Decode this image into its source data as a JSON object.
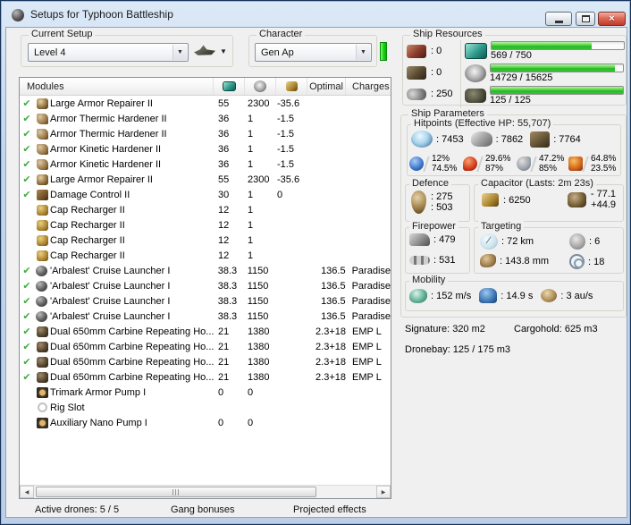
{
  "window": {
    "title": "Setups for Typhoon Battleship"
  },
  "setup": {
    "label": "Current Setup",
    "value": "Level 4"
  },
  "character": {
    "label": "Character",
    "value": "Gen Ap"
  },
  "modules_table": {
    "header": {
      "name": "Modules",
      "icons": [
        "cpu-icon",
        "powergrid-icon",
        "capacitor-icon"
      ],
      "optimal": "Optimal",
      "charges": "Charges"
    },
    "rows": [
      {
        "check": true,
        "icon": "repairer",
        "name": "Large Armor Repairer II",
        "cpu": "55",
        "pg": "2300",
        "cap": "-35.6",
        "optimal": "",
        "charges": ""
      },
      {
        "check": true,
        "icon": "hardener",
        "name": "Armor Thermic Hardener II",
        "cpu": "36",
        "pg": "1",
        "cap": "-1.5",
        "optimal": "",
        "charges": ""
      },
      {
        "check": true,
        "icon": "hardener",
        "name": "Armor Thermic Hardener II",
        "cpu": "36",
        "pg": "1",
        "cap": "-1.5",
        "optimal": "",
        "charges": ""
      },
      {
        "check": true,
        "icon": "hardener",
        "name": "Armor Kinetic Hardener II",
        "cpu": "36",
        "pg": "1",
        "cap": "-1.5",
        "optimal": "",
        "charges": ""
      },
      {
        "check": true,
        "icon": "hardener",
        "name": "Armor Kinetic Hardener II",
        "cpu": "36",
        "pg": "1",
        "cap": "-1.5",
        "optimal": "",
        "charges": ""
      },
      {
        "check": true,
        "icon": "repairer",
        "name": "Large Armor Repairer II",
        "cpu": "55",
        "pg": "2300",
        "cap": "-35.6",
        "optimal": "",
        "charges": ""
      },
      {
        "check": true,
        "icon": "damage-control",
        "name": "Damage Control II",
        "cpu": "30",
        "pg": "1",
        "cap": "0",
        "optimal": "",
        "charges": ""
      },
      {
        "check": false,
        "icon": "cap-recharger",
        "name": "Cap Recharger II",
        "cpu": "12",
        "pg": "1",
        "cap": "",
        "optimal": "",
        "charges": ""
      },
      {
        "check": false,
        "icon": "cap-recharger",
        "name": "Cap Recharger II",
        "cpu": "12",
        "pg": "1",
        "cap": "",
        "optimal": "",
        "charges": ""
      },
      {
        "check": false,
        "icon": "cap-recharger",
        "name": "Cap Recharger II",
        "cpu": "12",
        "pg": "1",
        "cap": "",
        "optimal": "",
        "charges": ""
      },
      {
        "check": false,
        "icon": "cap-recharger",
        "name": "Cap Recharger II",
        "cpu": "12",
        "pg": "1",
        "cap": "",
        "optimal": "",
        "charges": ""
      },
      {
        "check": true,
        "icon": "cruise-launcher",
        "name": "'Arbalest' Cruise Launcher I",
        "cpu": "38.3",
        "pg": "1150",
        "cap": "",
        "optimal": "136.5",
        "charges": "Paradise"
      },
      {
        "check": true,
        "icon": "cruise-launcher",
        "name": "'Arbalest' Cruise Launcher I",
        "cpu": "38.3",
        "pg": "1150",
        "cap": "",
        "optimal": "136.5",
        "charges": "Paradise"
      },
      {
        "check": true,
        "icon": "cruise-launcher",
        "name": "'Arbalest' Cruise Launcher I",
        "cpu": "38.3",
        "pg": "1150",
        "cap": "",
        "optimal": "136.5",
        "charges": "Paradise"
      },
      {
        "check": true,
        "icon": "cruise-launcher",
        "name": "'Arbalest' Cruise Launcher I",
        "cpu": "38.3",
        "pg": "1150",
        "cap": "",
        "optimal": "136.5",
        "charges": "Paradise"
      },
      {
        "check": true,
        "icon": "projectile-turret",
        "name": "Dual 650mm Carbine Repeating Ho...",
        "cpu": "21",
        "pg": "1380",
        "cap": "",
        "optimal": "2.3+18",
        "charges": "EMP L"
      },
      {
        "check": true,
        "icon": "projectile-turret",
        "name": "Dual 650mm Carbine Repeating Ho...",
        "cpu": "21",
        "pg": "1380",
        "cap": "",
        "optimal": "2.3+18",
        "charges": "EMP L"
      },
      {
        "check": true,
        "icon": "projectile-turret",
        "name": "Dual 650mm Carbine Repeating Ho...",
        "cpu": "21",
        "pg": "1380",
        "cap": "",
        "optimal": "2.3+18",
        "charges": "EMP L"
      },
      {
        "check": true,
        "icon": "projectile-turret",
        "name": "Dual 650mm Carbine Repeating Ho...",
        "cpu": "21",
        "pg": "1380",
        "cap": "",
        "optimal": "2.3+18",
        "charges": "EMP L"
      },
      {
        "check": false,
        "icon": "rig",
        "name": "Trimark Armor Pump I",
        "cpu": "0",
        "pg": "0",
        "cap": "",
        "optimal": "",
        "charges": ""
      },
      {
        "check": false,
        "icon": "rig-empty",
        "name": "Rig Slot",
        "cpu": "",
        "pg": "",
        "cap": "",
        "optimal": "",
        "charges": ""
      },
      {
        "check": false,
        "icon": "rig",
        "name": "Auxiliary Nano Pump I",
        "cpu": "0",
        "pg": "0",
        "cap": "",
        "optimal": "",
        "charges": ""
      }
    ]
  },
  "status_bar": {
    "active_drones": "Active drones: 5 / 5",
    "gang_bonuses": "Gang bonuses",
    "projected_effects": "Projected effects"
  },
  "ship_resources": {
    "title": "Ship Resources",
    "turret_hardpoints": ": 0",
    "launcher_hardpoints": ": 0",
    "calibration": ": 250",
    "cpu": {
      "text": "569 / 750",
      "pct": 76
    },
    "powergrid": {
      "text": "14729 / 15625",
      "pct": 94
    },
    "dronebay": {
      "text": "125 / 125",
      "pct": 100
    },
    "bar_color": "#2db82d"
  },
  "ship_parameters": {
    "title": "Ship Parameters",
    "hitpoints": {
      "title": "Hitpoints (Effective HP: 55,707)",
      "shield": ": 7453",
      "armor": ": 7862",
      "structure": ": 7764",
      "resists": [
        {
          "top": "12%",
          "bottom": "74.5%"
        },
        {
          "top": "29.6%",
          "bottom": "87%"
        },
        {
          "top": "47.2%",
          "bottom": "85%"
        },
        {
          "top": "64.8%",
          "bottom": "23.5%"
        }
      ]
    },
    "defence": {
      "title": "Defence",
      "value1": ": 275",
      "value2": ": 503"
    },
    "capacitor": {
      "title": "Capacitor (Lasts: 2m 23s)",
      "amount": ": 6250",
      "drain": "- 77.1",
      "recharge": "+44.9"
    },
    "firepower": {
      "title": "Firepower",
      "turret": ": 479",
      "missile": ": 531"
    },
    "targeting": {
      "title": "Targeting",
      "range": ": 72 km",
      "max_targets": ": 6",
      "sig_resolution": ": 143.8 mm",
      "scan_resolution": ": 18"
    },
    "mobility": {
      "title": "Mobility",
      "speed": ": 152 m/s",
      "align": ": 14.9 s",
      "warp": ": 3 au/s"
    },
    "signature": "Signature: 320 m2",
    "cargohold": "Cargohold: 625 m3",
    "dronebay": "Dronebay: 125 / 175 m3"
  }
}
